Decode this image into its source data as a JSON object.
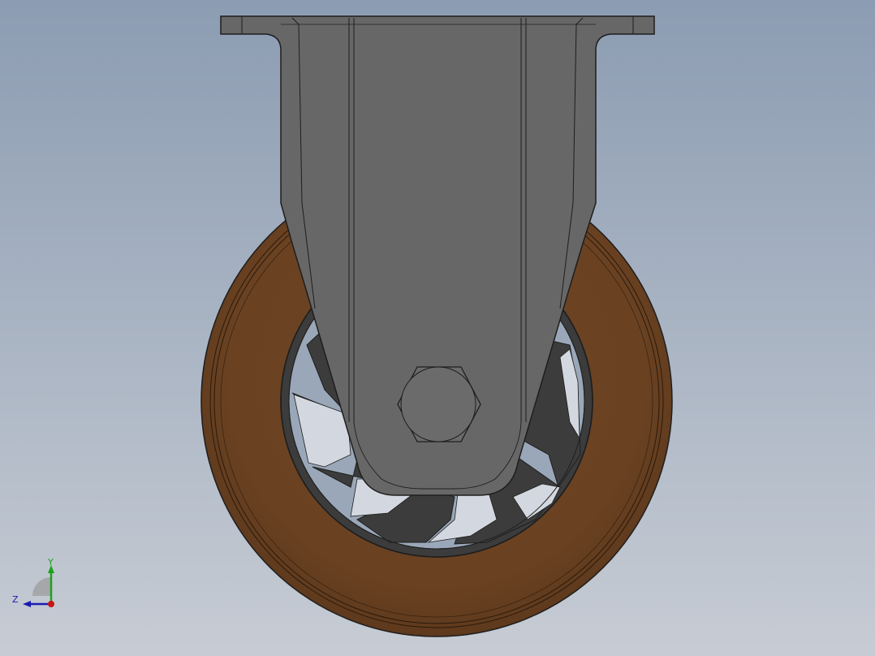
{
  "viewport": {
    "background_top": "#8c9cb2",
    "background_bottom": "#c7ccd4"
  },
  "model": {
    "part_colors": {
      "tread": "#6a4222",
      "bracket": "#676767",
      "hub": "#3c3c3c",
      "edge_lines": "#1e1e1e"
    }
  },
  "triad": {
    "y_label": "Y",
    "z_label": "Z",
    "y_color": "#1aa31a",
    "z_color": "#1a1ab0",
    "x_color": "#c81414"
  }
}
